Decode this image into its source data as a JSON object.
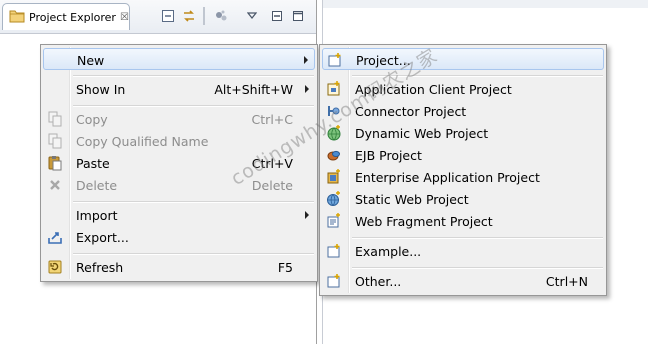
{
  "view": {
    "tab_label": "Project Explorer",
    "close_glyph": "☒"
  },
  "context_menu": {
    "items": [
      {
        "label": "New",
        "accelerator": "",
        "submenu": true,
        "enabled": true,
        "icon": null
      },
      {
        "label": "Show In",
        "accelerator": "Alt+Shift+W",
        "submenu": true,
        "enabled": true,
        "icon": null
      },
      {
        "label": "Copy",
        "accelerator": "Ctrl+C",
        "submenu": false,
        "enabled": false,
        "icon": "copy-icon"
      },
      {
        "label": "Copy Qualified Name",
        "accelerator": "",
        "submenu": false,
        "enabled": false,
        "icon": "copy-qualified-name-icon"
      },
      {
        "label": "Paste",
        "accelerator": "Ctrl+V",
        "submenu": false,
        "enabled": true,
        "icon": "paste-icon"
      },
      {
        "label": "Delete",
        "accelerator": "Delete",
        "submenu": false,
        "enabled": false,
        "icon": "delete-icon"
      },
      {
        "label": "Import",
        "accelerator": "",
        "submenu": true,
        "enabled": true,
        "icon": null
      },
      {
        "label": "Export...",
        "accelerator": "",
        "submenu": false,
        "enabled": true,
        "icon": "export-icon"
      },
      {
        "label": "Refresh",
        "accelerator": "F5",
        "submenu": false,
        "enabled": true,
        "icon": "refresh-icon"
      }
    ]
  },
  "new_submenu": {
    "items": [
      {
        "label": "Project...",
        "accelerator": "",
        "icon": "new-project-icon"
      },
      {
        "label": "Application Client Project",
        "accelerator": "",
        "icon": "application-client-project-icon"
      },
      {
        "label": "Connector Project",
        "accelerator": "",
        "icon": "connector-project-icon"
      },
      {
        "label": "Dynamic Web Project",
        "accelerator": "",
        "icon": "dynamic-web-project-icon"
      },
      {
        "label": "EJB Project",
        "accelerator": "",
        "icon": "ejb-project-icon"
      },
      {
        "label": "Enterprise Application Project",
        "accelerator": "",
        "icon": "enterprise-application-project-icon"
      },
      {
        "label": "Static Web Project",
        "accelerator": "",
        "icon": "static-web-project-icon"
      },
      {
        "label": "Web Fragment Project",
        "accelerator": "",
        "icon": "web-fragment-project-icon"
      },
      {
        "label": "Example...",
        "accelerator": "",
        "icon": "example-icon"
      },
      {
        "label": "Other...",
        "accelerator": "Ctrl+N",
        "icon": "other-wizard-icon"
      }
    ]
  },
  "watermark": "codingwhy.com码农之家",
  "colors": {
    "menu_bg": "#f0f0f0",
    "highlight_border": "#a8c6ee",
    "disabled_text": "#8d8d8d"
  }
}
